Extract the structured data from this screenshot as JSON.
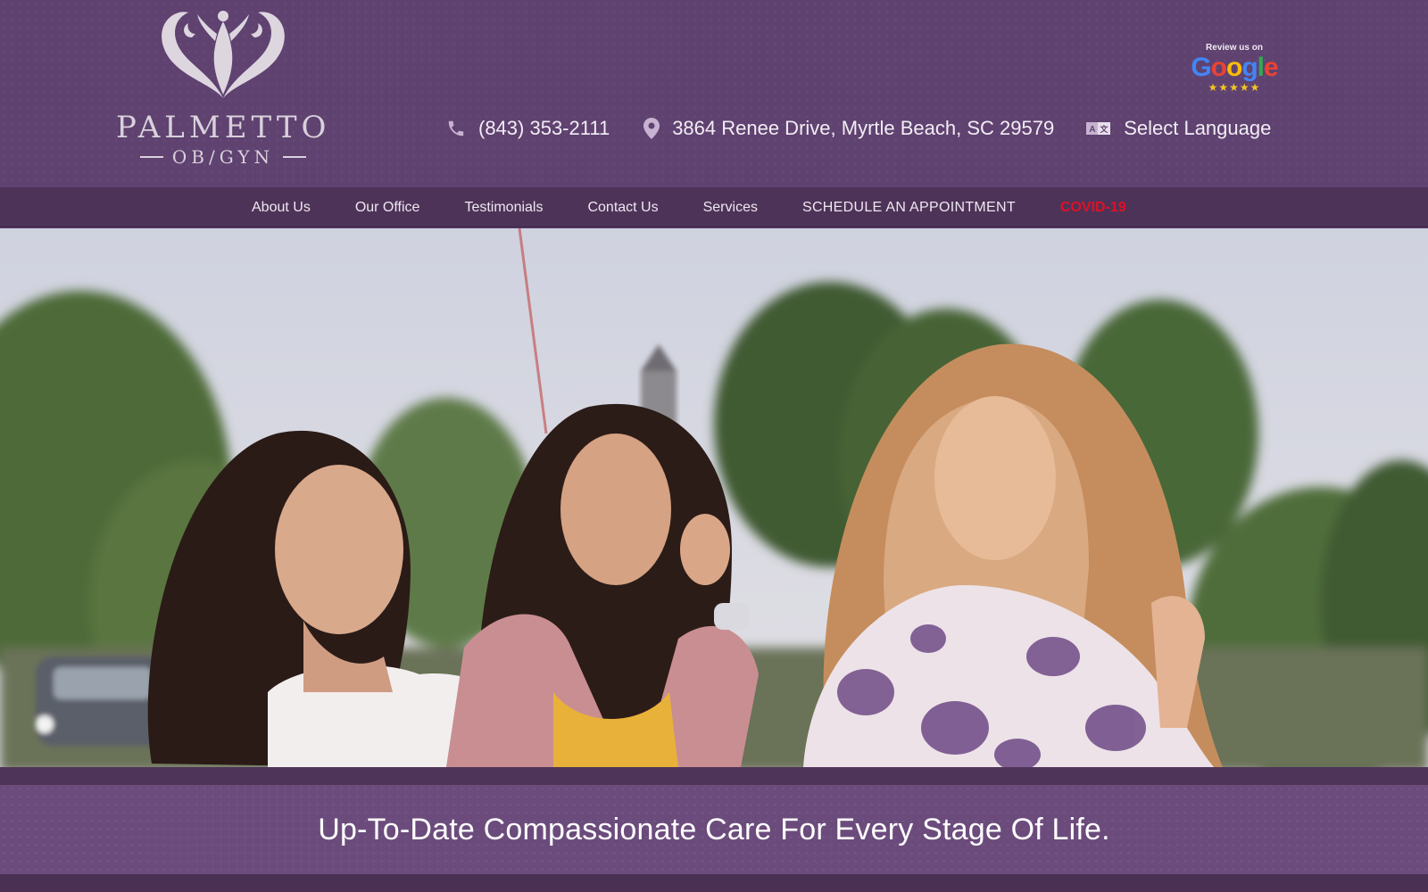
{
  "brand": {
    "name": "PALMETTO",
    "subtitle": "OB/GYN",
    "colors": {
      "header_bg": "#5f4270",
      "nav_bg": "#4e3358",
      "covid_red": "#e01024",
      "band_bg": "#6b4b7c"
    }
  },
  "contact": {
    "phone": "(843) 353-2111",
    "phone_icon": "phone-icon",
    "address": "3864 Renee Drive, Myrtle Beach, SC 29579",
    "address_icon": "map-pin-icon",
    "language": "Select Language",
    "language_icon": "translate-icon"
  },
  "review_badge": {
    "caption": "Review us on",
    "brand": "Google",
    "stars": "★★★★★"
  },
  "nav": {
    "items": [
      {
        "label": "About Us"
      },
      {
        "label": "Our Office"
      },
      {
        "label": "Testimonials"
      },
      {
        "label": "Contact Us"
      },
      {
        "label": "Services"
      },
      {
        "label": "SCHEDULE AN APPOINTMENT"
      },
      {
        "label": "COVID-19"
      }
    ]
  },
  "hero": {
    "tagline": "Up-To-Date Compassionate Care For Every Stage Of Life."
  }
}
